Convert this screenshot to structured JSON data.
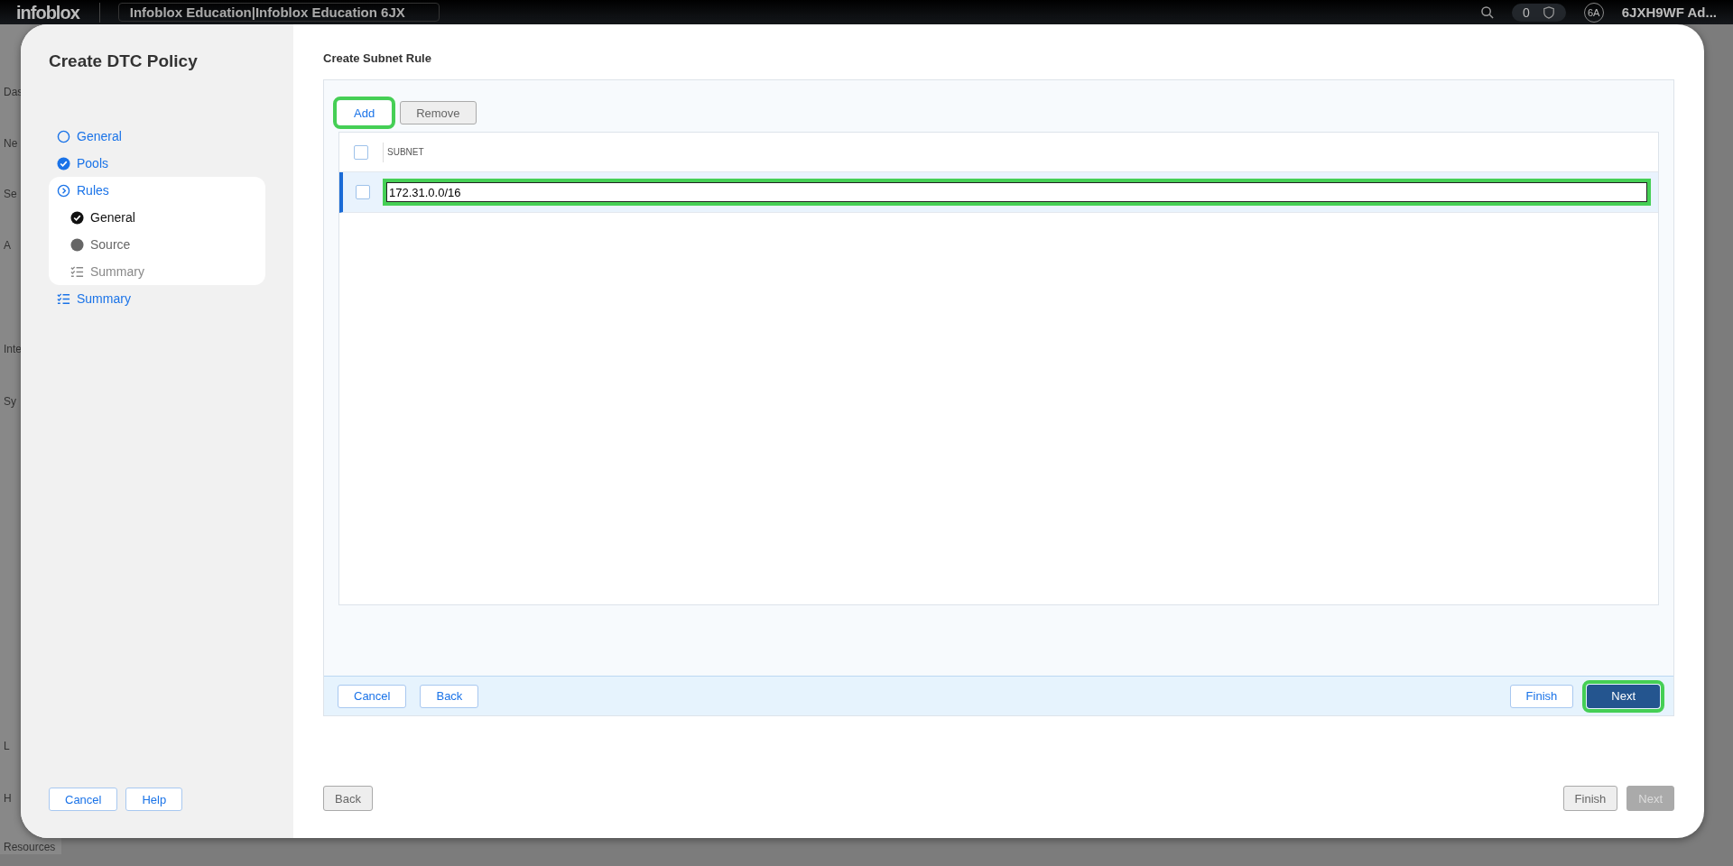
{
  "top_bar": {
    "logo": "infoblox",
    "account_selector": "Infoblox Education|Infoblox Education 6JX",
    "notification_count": "0",
    "avatar": "6A",
    "user": "6JXH9WF Ad..."
  },
  "nav_fragments": [
    "Das",
    "Ne",
    "Se",
    "A",
    "Inte",
    "Sy",
    "L",
    "H",
    "Resources"
  ],
  "dialog": {
    "title": "Create DTC Policy",
    "steps": [
      {
        "label": "General",
        "kind": "circle"
      },
      {
        "label": "Pools",
        "kind": "check"
      },
      {
        "label": "Rules",
        "kind": "chevron",
        "expanded": true,
        "children": [
          {
            "label": "General",
            "kind": "check",
            "color": "#111111"
          },
          {
            "label": "Source",
            "kind": "dot",
            "color": "#666666"
          },
          {
            "label": "Summary",
            "kind": "checklist",
            "color": "#888888"
          }
        ]
      },
      {
        "label": "Summary",
        "kind": "checklist"
      }
    ],
    "left_buttons": [
      "Cancel",
      "Help"
    ],
    "section_title": "Create Subnet Rule",
    "toolbar": [
      {
        "label": "Add",
        "kind": "link",
        "highlighted": true
      },
      {
        "label": "Remove",
        "kind": "gray",
        "highlighted": false
      }
    ],
    "table": {
      "columns": [
        "SUBNET"
      ],
      "header_checked": false,
      "rows": [
        {
          "checked": false,
          "selected": true,
          "value": "172.31.0.0/16",
          "highlighted": true
        }
      ]
    },
    "panel_footer_left": [
      {
        "label": "Cancel",
        "kind": "outline",
        "highlighted": false
      },
      {
        "label": "Back",
        "kind": "outline",
        "highlighted": false
      }
    ],
    "panel_footer_right": [
      {
        "label": "Finish",
        "kind": "outline",
        "highlighted": false
      },
      {
        "label": "Next",
        "kind": "primary",
        "highlighted": true
      }
    ],
    "footer_left": [
      {
        "label": "Back",
        "kind": "gray",
        "highlighted": false
      }
    ],
    "footer_right": [
      {
        "label": "Finish",
        "kind": "gray",
        "highlighted": false
      },
      {
        "label": "Next",
        "kind": "disabled",
        "highlighted": false
      }
    ]
  }
}
